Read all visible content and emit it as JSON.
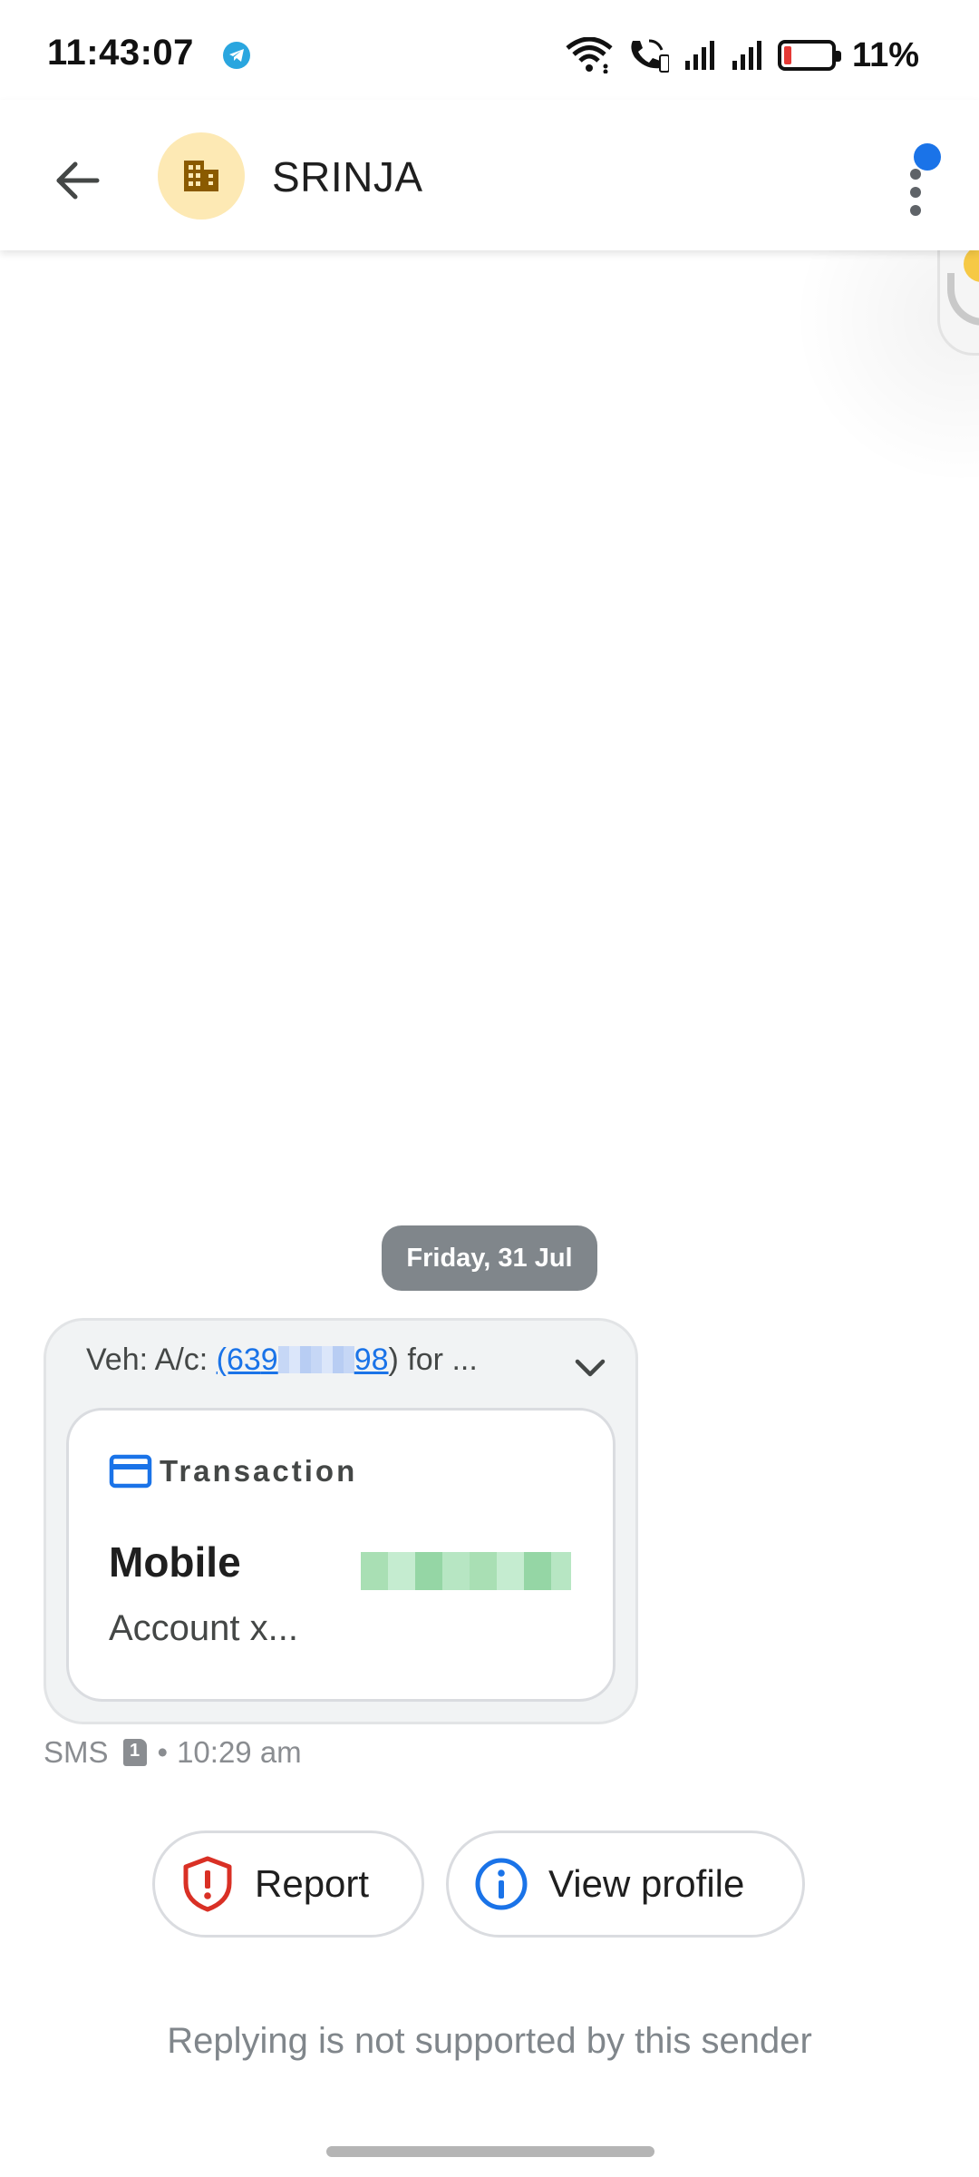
{
  "status_bar": {
    "time": "11:43:07",
    "battery_percent": "11%",
    "battery_level": 0.11,
    "icons": [
      "telegram-icon",
      "wifi-icon",
      "wifi-calling-icon",
      "signal-icon",
      "signal-icon",
      "battery-icon"
    ]
  },
  "app_bar": {
    "contact_name": "SRINJA",
    "avatar_icon": "business-icon",
    "avatar_color": "#fde9b4",
    "menu_badge_color": "#1a73e8"
  },
  "conversation": {
    "date_chip": "Friday, 31 Jul",
    "message": {
      "header_prefix": "Veh: A/c: ",
      "account_open": "(63",
      "account_start": "9",
      "account_end": "98",
      "account_close": ")",
      "header_suffix": " for ...",
      "card": {
        "type_label": "Transaction",
        "title": "Mobile",
        "subtitle": "Account x..."
      },
      "meta": {
        "channel": "SMS",
        "sim": "1",
        "separator": "•",
        "time": "10:29 am"
      }
    }
  },
  "actions": {
    "report_label": "Report",
    "view_profile_label": "View profile"
  },
  "footer": {
    "reply_note": "Replying is not supported by this sender"
  },
  "colors": {
    "accent": "#1a73e8",
    "report_red": "#d93025",
    "chip_gray": "#80868b"
  }
}
